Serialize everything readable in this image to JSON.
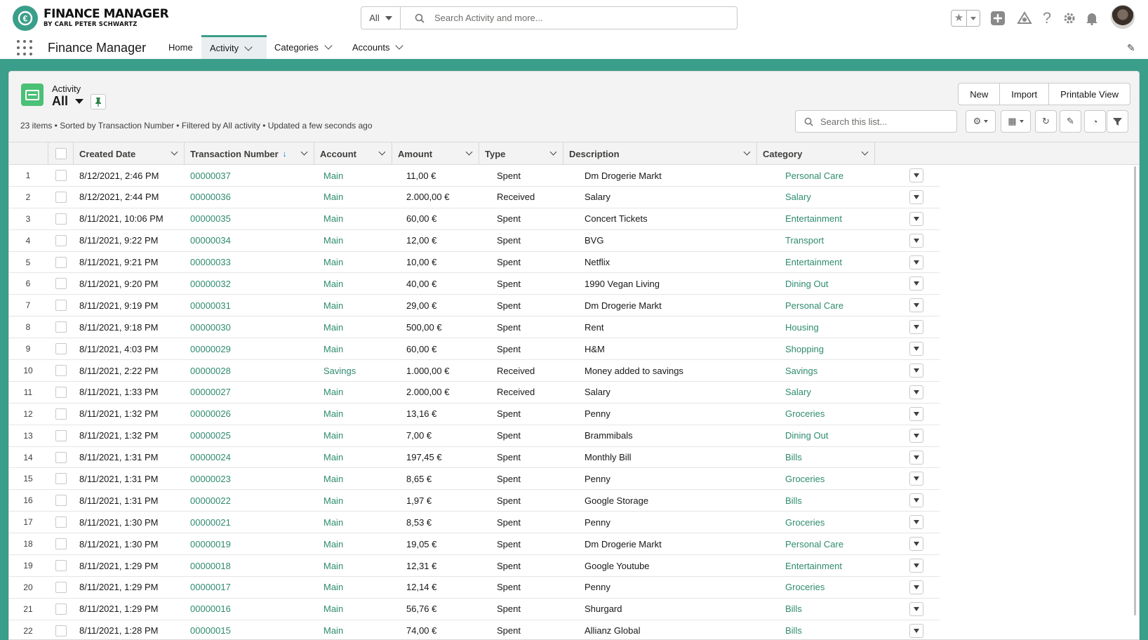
{
  "header": {
    "logo_title": "FINANCE MANAGER",
    "logo_subtitle": "BY CARL PETER SCHWARTZ",
    "search_scope": "All",
    "search_placeholder": "Search Activity and more..."
  },
  "nav": {
    "app_name": "Finance Manager",
    "items": [
      {
        "label": "Home"
      },
      {
        "label": "Activity"
      },
      {
        "label": "Categories"
      },
      {
        "label": "Accounts"
      }
    ]
  },
  "list_view": {
    "object_label": "Activity",
    "list_name": "All",
    "buttons": {
      "new": "New",
      "import": "Import",
      "printable": "Printable View"
    },
    "meta": "23 items • Sorted by Transaction Number • Filtered by All activity • Updated a few seconds ago",
    "search_placeholder": "Search this list..."
  },
  "table": {
    "columns": [
      "Created Date",
      "Transaction Number",
      "Account",
      "Amount",
      "Type",
      "Description",
      "Category"
    ],
    "rows": [
      {
        "n": "1",
        "date": "8/12/2021, 2:46 PM",
        "txn": "00000037",
        "acct": "Main",
        "amt": "11,00 €",
        "type": "Spent",
        "desc": "Dm Drogerie Markt",
        "cat": "Personal Care"
      },
      {
        "n": "2",
        "date": "8/12/2021, 2:44 PM",
        "txn": "00000036",
        "acct": "Main",
        "amt": "2.000,00 €",
        "type": "Received",
        "desc": "Salary",
        "cat": "Salary"
      },
      {
        "n": "3",
        "date": "8/11/2021, 10:06 PM",
        "txn": "00000035",
        "acct": "Main",
        "amt": "60,00 €",
        "type": "Spent",
        "desc": "Concert Tickets",
        "cat": "Entertainment"
      },
      {
        "n": "4",
        "date": "8/11/2021, 9:22 PM",
        "txn": "00000034",
        "acct": "Main",
        "amt": "12,00 €",
        "type": "Spent",
        "desc": "BVG",
        "cat": "Transport"
      },
      {
        "n": "5",
        "date": "8/11/2021, 9:21 PM",
        "txn": "00000033",
        "acct": "Main",
        "amt": "10,00 €",
        "type": "Spent",
        "desc": "Netflix",
        "cat": "Entertainment"
      },
      {
        "n": "6",
        "date": "8/11/2021, 9:20 PM",
        "txn": "00000032",
        "acct": "Main",
        "amt": "40,00 €",
        "type": "Spent",
        "desc": "1990 Vegan Living",
        "cat": "Dining Out"
      },
      {
        "n": "7",
        "date": "8/11/2021, 9:19 PM",
        "txn": "00000031",
        "acct": "Main",
        "amt": "29,00 €",
        "type": "Spent",
        "desc": "Dm Drogerie Markt",
        "cat": "Personal Care"
      },
      {
        "n": "8",
        "date": "8/11/2021, 9:18 PM",
        "txn": "00000030",
        "acct": "Main",
        "amt": "500,00 €",
        "type": "Spent",
        "desc": "Rent",
        "cat": "Housing"
      },
      {
        "n": "9",
        "date": "8/11/2021, 4:03 PM",
        "txn": "00000029",
        "acct": "Main",
        "amt": "60,00 €",
        "type": "Spent",
        "desc": "H&M",
        "cat": "Shopping"
      },
      {
        "n": "10",
        "date": "8/11/2021, 2:22 PM",
        "txn": "00000028",
        "acct": "Savings",
        "amt": "1.000,00 €",
        "type": "Received",
        "desc": "Money added to savings",
        "cat": "Savings"
      },
      {
        "n": "11",
        "date": "8/11/2021, 1:33 PM",
        "txn": "00000027",
        "acct": "Main",
        "amt": "2.000,00 €",
        "type": "Received",
        "desc": "Salary",
        "cat": "Salary"
      },
      {
        "n": "12",
        "date": "8/11/2021, 1:32 PM",
        "txn": "00000026",
        "acct": "Main",
        "amt": "13,16 €",
        "type": "Spent",
        "desc": "Penny",
        "cat": "Groceries"
      },
      {
        "n": "13",
        "date": "8/11/2021, 1:32 PM",
        "txn": "00000025",
        "acct": "Main",
        "amt": "7,00 €",
        "type": "Spent",
        "desc": "Brammibals",
        "cat": "Dining Out"
      },
      {
        "n": "14",
        "date": "8/11/2021, 1:31 PM",
        "txn": "00000024",
        "acct": "Main",
        "amt": "197,45 €",
        "type": "Spent",
        "desc": "Monthly Bill",
        "cat": "Bills"
      },
      {
        "n": "15",
        "date": "8/11/2021, 1:31 PM",
        "txn": "00000023",
        "acct": "Main",
        "amt": "8,65 €",
        "type": "Spent",
        "desc": "Penny",
        "cat": "Groceries"
      },
      {
        "n": "16",
        "date": "8/11/2021, 1:31 PM",
        "txn": "00000022",
        "acct": "Main",
        "amt": "1,97 €",
        "type": "Spent",
        "desc": "Google Storage",
        "cat": "Bills"
      },
      {
        "n": "17",
        "date": "8/11/2021, 1:30 PM",
        "txn": "00000021",
        "acct": "Main",
        "amt": "8,53 €",
        "type": "Spent",
        "desc": "Penny",
        "cat": "Groceries"
      },
      {
        "n": "18",
        "date": "8/11/2021, 1:30 PM",
        "txn": "00000019",
        "acct": "Main",
        "amt": "19,05 €",
        "type": "Spent",
        "desc": "Dm Drogerie Markt",
        "cat": "Personal Care"
      },
      {
        "n": "19",
        "date": "8/11/2021, 1:29 PM",
        "txn": "00000018",
        "acct": "Main",
        "amt": "12,31 €",
        "type": "Spent",
        "desc": "Google Youtube",
        "cat": "Entertainment"
      },
      {
        "n": "20",
        "date": "8/11/2021, 1:29 PM",
        "txn": "00000017",
        "acct": "Main",
        "amt": "12,14 €",
        "type": "Spent",
        "desc": "Penny",
        "cat": "Groceries"
      },
      {
        "n": "21",
        "date": "8/11/2021, 1:29 PM",
        "txn": "00000016",
        "acct": "Main",
        "amt": "56,76 €",
        "type": "Spent",
        "desc": "Shurgard",
        "cat": "Bills"
      },
      {
        "n": "22",
        "date": "8/11/2021, 1:28 PM",
        "txn": "00000015",
        "acct": "Main",
        "amt": "74,00 €",
        "type": "Spent",
        "desc": "Allianz Global",
        "cat": "Bills"
      }
    ]
  },
  "colors": {
    "brand": "#3a9e8a",
    "link": "#2e8b6f",
    "object_icon": "#4bc076"
  },
  "icons": [
    "app-launcher-icon",
    "search-icon",
    "star-icon",
    "plus-icon",
    "cloud-icon",
    "help-icon",
    "gear-icon",
    "bell-icon",
    "pencil-icon",
    "pin-icon",
    "refresh-icon",
    "chart-icon",
    "filter-icon",
    "table-icon"
  ]
}
